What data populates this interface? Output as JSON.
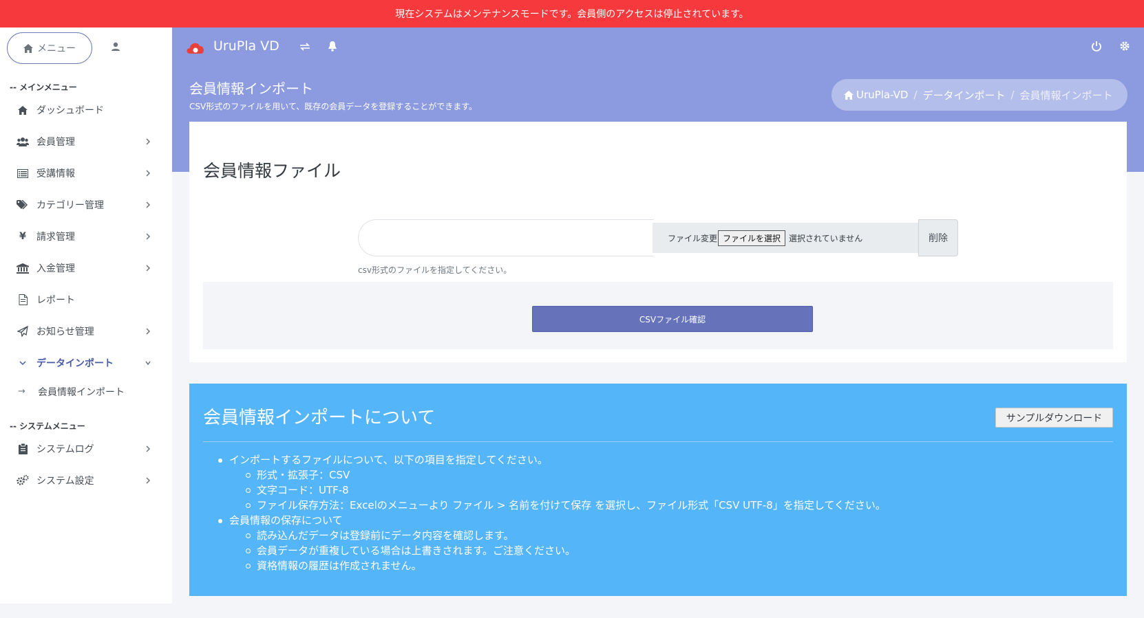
{
  "maintenance_notice": "現在システムはメンテナンスモードです。会員側のアクセスは停止されています。",
  "sidebar": {
    "menu_button": "メニュー",
    "main_section": "-- メインメニュー",
    "items": [
      {
        "label": "ダッシュボード",
        "icon": "home-icon"
      },
      {
        "label": "会員管理",
        "icon": "users-icon"
      },
      {
        "label": "受講情報",
        "icon": "list-icon"
      },
      {
        "label": "カテゴリー管理",
        "icon": "tags-icon"
      },
      {
        "label": "請求管理",
        "icon": "yen-icon"
      },
      {
        "label": "入金管理",
        "icon": "bank-icon"
      },
      {
        "label": "レポート",
        "icon": "file-icon"
      },
      {
        "label": "お知らせ管理",
        "icon": "paper-plane-icon"
      },
      {
        "label": "データインポート",
        "icon": "chevron-down-icon"
      }
    ],
    "sub_items": [
      {
        "label": "会員情報インポート"
      }
    ],
    "system_section": "-- システムメニュー",
    "system_items": [
      {
        "label": "システムログ",
        "icon": "clipboard-icon"
      },
      {
        "label": "システム設定",
        "icon": "cogs-icon"
      }
    ]
  },
  "topbar": {
    "brand": "UruPla VD"
  },
  "page": {
    "title": "会員情報インポート",
    "description": "CSV形式のファイルを用いて、既存の会員データを登録することができます。",
    "breadcrumb": {
      "home": "UruPla-VD",
      "section": "データインポート",
      "current": "会員情報インポート",
      "separator": "/"
    }
  },
  "upload_card": {
    "title": "会員情報ファイル",
    "file_change_label": "ファイル変更",
    "choose_button": "ファイルを選択",
    "no_file": "選択されていません",
    "delete_button": "削除",
    "hint": "csv形式のファイルを指定してください。",
    "confirm_button": "CSVファイル確認"
  },
  "info_card": {
    "title": "会員情報インポートについて",
    "sample_button": "サンプルダウンロード",
    "section1": "インポートするファイルについて、以下の項目を指定してください。",
    "section1_items": [
      "形式・拡張子：CSV",
      "文字コード：UTF-8",
      "ファイル保存方法：Excelのメニューより ファイル > 名前を付けて保存 を選択し、ファイル形式「CSV UTF-8」を指定してください。"
    ],
    "section2": "会員情報の保存について",
    "section2_items": [
      "読み込んだデータは登録前にデータ内容を確認します。",
      "会員データが重複している場合は上書きされます。ご注意ください。",
      "資格情報の履歴は作成されません。"
    ]
  },
  "colors": {
    "maintenance": "#f6393c",
    "header": "#8c9be0",
    "primary_button": "#6673bb",
    "info_card": "#55b5f9"
  }
}
